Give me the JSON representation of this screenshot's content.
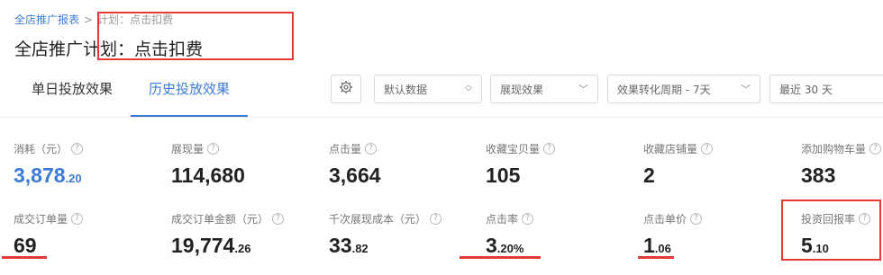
{
  "breadcrumb": {
    "root": "全店推广报表",
    "separator": ">",
    "current": "计划：点击扣费"
  },
  "page_title": "全店推广计划：点击扣费",
  "tabs": [
    {
      "label": "单日投放效果",
      "active": false
    },
    {
      "label": "历史投放效果",
      "active": true
    }
  ],
  "toolbar": {
    "settings_icon": "gear-icon",
    "data_select": "默认数据",
    "display_select": "展现效果",
    "conversion_select": "效果转化周期 - 7天",
    "date_select": "最近 30 天"
  },
  "metrics_row1": [
    {
      "label": "消耗（元）",
      "int": "3,878",
      "dec": ".20",
      "color": "#3d7bd9"
    },
    {
      "label": "展现量",
      "int": "114,680",
      "dec": ""
    },
    {
      "label": "点击量",
      "int": "3,664",
      "dec": ""
    },
    {
      "label": "收藏宝贝量",
      "int": "105",
      "dec": ""
    },
    {
      "label": "收藏店铺量",
      "int": "2",
      "dec": ""
    },
    {
      "label": "添加购物车量",
      "int": "383",
      "dec": ""
    }
  ],
  "metrics_row2": [
    {
      "label": "成交订单量",
      "int": "69",
      "dec": ""
    },
    {
      "label": "成交订单金额（元）",
      "int": "19,774",
      "dec": ".26"
    },
    {
      "label": "千次展现成本（元）",
      "int": "33",
      "dec": ".82"
    },
    {
      "label": "点击率",
      "int": "3",
      "dec": ".20%"
    },
    {
      "label": "点击单价",
      "int": "1",
      "dec": ".06"
    },
    {
      "label": "投资回报率",
      "int": "5",
      "dec": ".10"
    }
  ],
  "colors": {
    "accent": "#3d7bd9",
    "highlight": "#e53935"
  }
}
